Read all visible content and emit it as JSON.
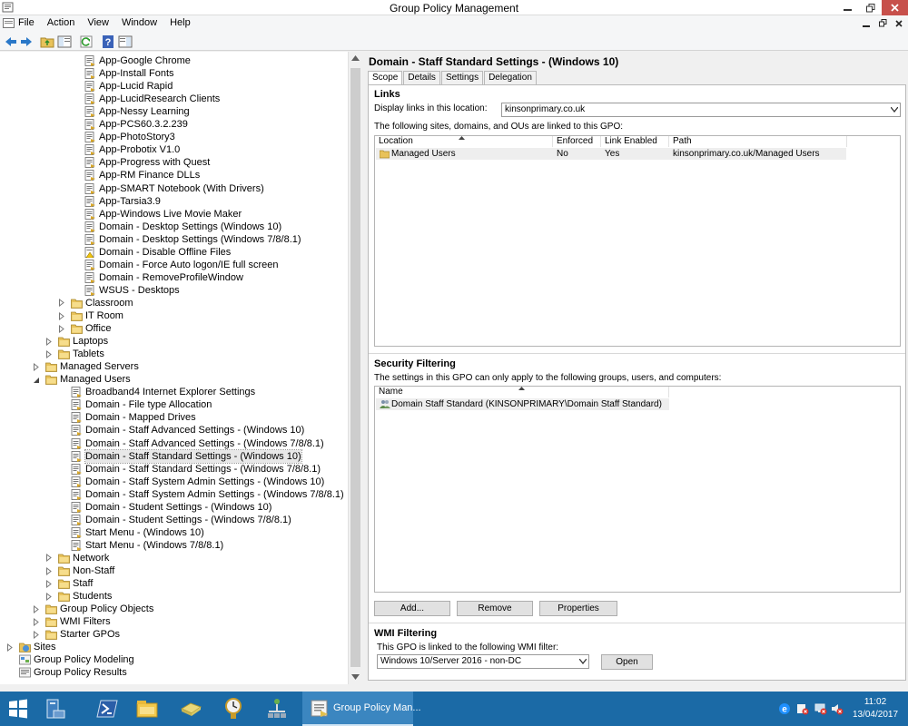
{
  "window": {
    "title": "Group Policy Management"
  },
  "menu": [
    "File",
    "Action",
    "View",
    "Window",
    "Help"
  ],
  "tree": [
    {
      "label": "App-Google Chrome",
      "indent": 93,
      "icon": "gpo",
      "exp": ""
    },
    {
      "label": "App-Install Fonts",
      "indent": 93,
      "icon": "gpo",
      "exp": ""
    },
    {
      "label": "App-Lucid Rapid",
      "indent": 93,
      "icon": "gpo",
      "exp": ""
    },
    {
      "label": "App-LucidResearch Clients",
      "indent": 93,
      "icon": "gpo",
      "exp": ""
    },
    {
      "label": "App-Nessy Learning",
      "indent": 93,
      "icon": "gpo",
      "exp": ""
    },
    {
      "label": "App-PCS60.3.2.239",
      "indent": 93,
      "icon": "gpo",
      "exp": ""
    },
    {
      "label": "App-PhotoStory3",
      "indent": 93,
      "icon": "gpo",
      "exp": ""
    },
    {
      "label": "App-Probotix V1.0",
      "indent": 93,
      "icon": "gpo",
      "exp": ""
    },
    {
      "label": "App-Progress with Quest",
      "indent": 93,
      "icon": "gpo",
      "exp": ""
    },
    {
      "label": "App-RM Finance DLLs",
      "indent": 93,
      "icon": "gpo",
      "exp": ""
    },
    {
      "label": "App-SMART Notebook (With Drivers)",
      "indent": 93,
      "icon": "gpo",
      "exp": ""
    },
    {
      "label": "App-Tarsia3.9",
      "indent": 93,
      "icon": "gpo",
      "exp": ""
    },
    {
      "label": "App-Windows Live Movie Maker",
      "indent": 93,
      "icon": "gpo",
      "exp": ""
    },
    {
      "label": "Domain - Desktop Settings (Windows 10)",
      "indent": 93,
      "icon": "gpo",
      "exp": ""
    },
    {
      "label": "Domain - Desktop Settings (Windows 7/8/8.1)",
      "indent": 93,
      "icon": "gpo",
      "exp": ""
    },
    {
      "label": "Domain - Disable Offline Files",
      "indent": 93,
      "icon": "gpo-warn",
      "exp": ""
    },
    {
      "label": "Domain - Force Auto logon/IE full screen",
      "indent": 93,
      "icon": "gpo",
      "exp": ""
    },
    {
      "label": "Domain - RemoveProfileWindow",
      "indent": 93,
      "icon": "gpo",
      "exp": ""
    },
    {
      "label": "WSUS - Desktops",
      "indent": 93,
      "icon": "gpo",
      "exp": ""
    },
    {
      "label": "Classroom",
      "indent": 78,
      "icon": "folder",
      "exp": "right"
    },
    {
      "label": "IT Room",
      "indent": 78,
      "icon": "folder",
      "exp": "right"
    },
    {
      "label": "Office",
      "indent": 78,
      "icon": "folder",
      "exp": "right"
    },
    {
      "label": "Laptops",
      "indent": 64,
      "icon": "folder",
      "exp": "right"
    },
    {
      "label": "Tablets",
      "indent": 64,
      "icon": "folder",
      "exp": "right"
    },
    {
      "label": "Managed Servers",
      "indent": 50,
      "icon": "folder",
      "exp": "right"
    },
    {
      "label": "Managed Users",
      "indent": 50,
      "icon": "folder",
      "exp": "down"
    },
    {
      "label": "Broadband4 Internet Explorer Settings",
      "indent": 78,
      "icon": "gpo",
      "exp": ""
    },
    {
      "label": "Domain - File type Allocation",
      "indent": 78,
      "icon": "gpo",
      "exp": ""
    },
    {
      "label": "Domain - Mapped Drives",
      "indent": 78,
      "icon": "gpo",
      "exp": ""
    },
    {
      "label": "Domain - Staff Advanced Settings - (Windows 10)",
      "indent": 78,
      "icon": "gpo",
      "exp": ""
    },
    {
      "label": "Domain - Staff Advanced Settings - (Windows 7/8/8.1)",
      "indent": 78,
      "icon": "gpo",
      "exp": ""
    },
    {
      "label": "Domain - Staff Standard Settings - (Windows 10)",
      "indent": 78,
      "icon": "gpo",
      "exp": "",
      "selected": true
    },
    {
      "label": "Domain - Staff Standard Settings - (Windows 7/8/8.1)",
      "indent": 78,
      "icon": "gpo",
      "exp": ""
    },
    {
      "label": "Domain - Staff System Admin Settings - (Windows 10)",
      "indent": 78,
      "icon": "gpo",
      "exp": ""
    },
    {
      "label": "Domain - Staff System Admin Settings - (Windows 7/8/8.1)",
      "indent": 78,
      "icon": "gpo",
      "exp": ""
    },
    {
      "label": "Domain - Student Settings - (Windows 10)",
      "indent": 78,
      "icon": "gpo",
      "exp": ""
    },
    {
      "label": "Domain - Student Settings - (Windows 7/8/8.1)",
      "indent": 78,
      "icon": "gpo",
      "exp": ""
    },
    {
      "label": "Start Menu - (Windows 10)",
      "indent": 78,
      "icon": "gpo",
      "exp": ""
    },
    {
      "label": "Start Menu - (Windows 7/8/8.1)",
      "indent": 78,
      "icon": "gpo",
      "exp": ""
    },
    {
      "label": "Network",
      "indent": 64,
      "icon": "folder",
      "exp": "right"
    },
    {
      "label": "Non-Staff",
      "indent": 64,
      "icon": "folder",
      "exp": "right"
    },
    {
      "label": "Staff",
      "indent": 64,
      "icon": "folder",
      "exp": "right"
    },
    {
      "label": "Students",
      "indent": 64,
      "icon": "folder",
      "exp": "right"
    },
    {
      "label": "Group Policy Objects",
      "indent": 50,
      "icon": "folder",
      "exp": "right"
    },
    {
      "label": "WMI Filters",
      "indent": 50,
      "icon": "folder",
      "exp": "right"
    },
    {
      "label": "Starter GPOs",
      "indent": 50,
      "icon": "folder",
      "exp": "right"
    },
    {
      "label": "Sites",
      "indent": 21,
      "icon": "sites",
      "exp": "right"
    },
    {
      "label": "Group Policy Modeling",
      "indent": 21,
      "icon": "modeling",
      "exp": ""
    },
    {
      "label": "Group Policy Results",
      "indent": 21,
      "icon": "results",
      "exp": ""
    }
  ],
  "details": {
    "title": "Domain - Staff Standard Settings - (Windows 10)",
    "tabs": [
      "Scope",
      "Details",
      "Settings",
      "Delegation"
    ],
    "links": {
      "heading": "Links",
      "display_label": "Display links in this location:",
      "location_value": "kinsonprimary.co.uk",
      "description": "The following sites, domains, and OUs are linked to this GPO:",
      "columns": [
        "Location",
        "Enforced",
        "Link Enabled",
        "Path"
      ],
      "rows": [
        {
          "location": "Managed Users",
          "enforced": "No",
          "link_enabled": "Yes",
          "path": "kinsonprimary.co.uk/Managed Users"
        }
      ]
    },
    "security": {
      "heading": "Security Filtering",
      "description": "The settings in this GPO can only apply to the following groups, users, and computers:",
      "columns": [
        "Name"
      ],
      "rows": [
        "Domain Staff Standard (KINSONPRIMARY\\Domain Staff Standard)"
      ],
      "add_label": "Add...",
      "remove_label": "Remove",
      "properties_label": "Properties"
    },
    "wmi": {
      "heading": "WMI Filtering",
      "description": "This GPO is linked to the following WMI filter:",
      "filter_value": "Windows 10/Server 2016 - non-DC",
      "open_label": "Open"
    }
  },
  "taskbar": {
    "active_label": "Group Policy Man...",
    "time": "11:02",
    "date": "13/04/2017"
  }
}
